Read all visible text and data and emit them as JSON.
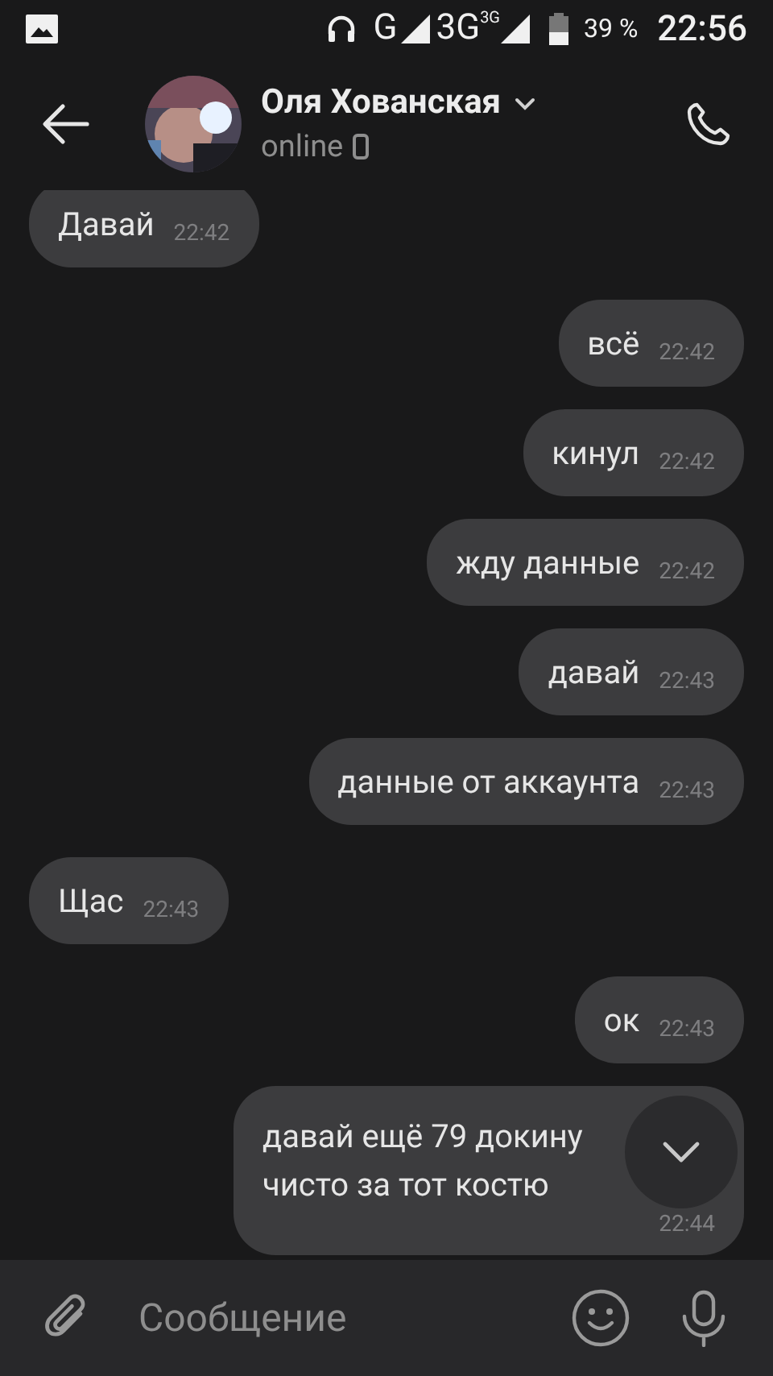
{
  "status_bar": {
    "network_1": "G",
    "network_2": "3G",
    "network_2_badge": "3G",
    "battery": "39 %",
    "time": "22:56"
  },
  "header": {
    "name": "Оля Хованская",
    "presence": "online"
  },
  "messages": [
    {
      "kind": "incoming",
      "lines": [
        "Давай"
      ],
      "time": "22:42"
    },
    {
      "kind": "outgoing",
      "lines": [
        "всё"
      ],
      "time": "22:42"
    },
    {
      "kind": "outgoing",
      "lines": [
        "кинул"
      ],
      "time": "22:42"
    },
    {
      "kind": "outgoing",
      "lines": [
        "жду данные"
      ],
      "time": "22:42"
    },
    {
      "kind": "outgoing",
      "lines": [
        "давай"
      ],
      "time": "22:43"
    },
    {
      "kind": "outgoing",
      "lines": [
        "данные от аккаунта"
      ],
      "time": "22:43"
    },
    {
      "kind": "incoming",
      "lines": [
        "Щас"
      ],
      "time": "22:43"
    },
    {
      "kind": "outgoing",
      "lines": [
        "ок"
      ],
      "time": "22:43"
    },
    {
      "kind": "outgoing",
      "lines": [
        "давай ещё 79 докину",
        "чисто за тот костю"
      ],
      "time": "22:44"
    }
  ],
  "composer": {
    "placeholder": "Сообщение"
  }
}
